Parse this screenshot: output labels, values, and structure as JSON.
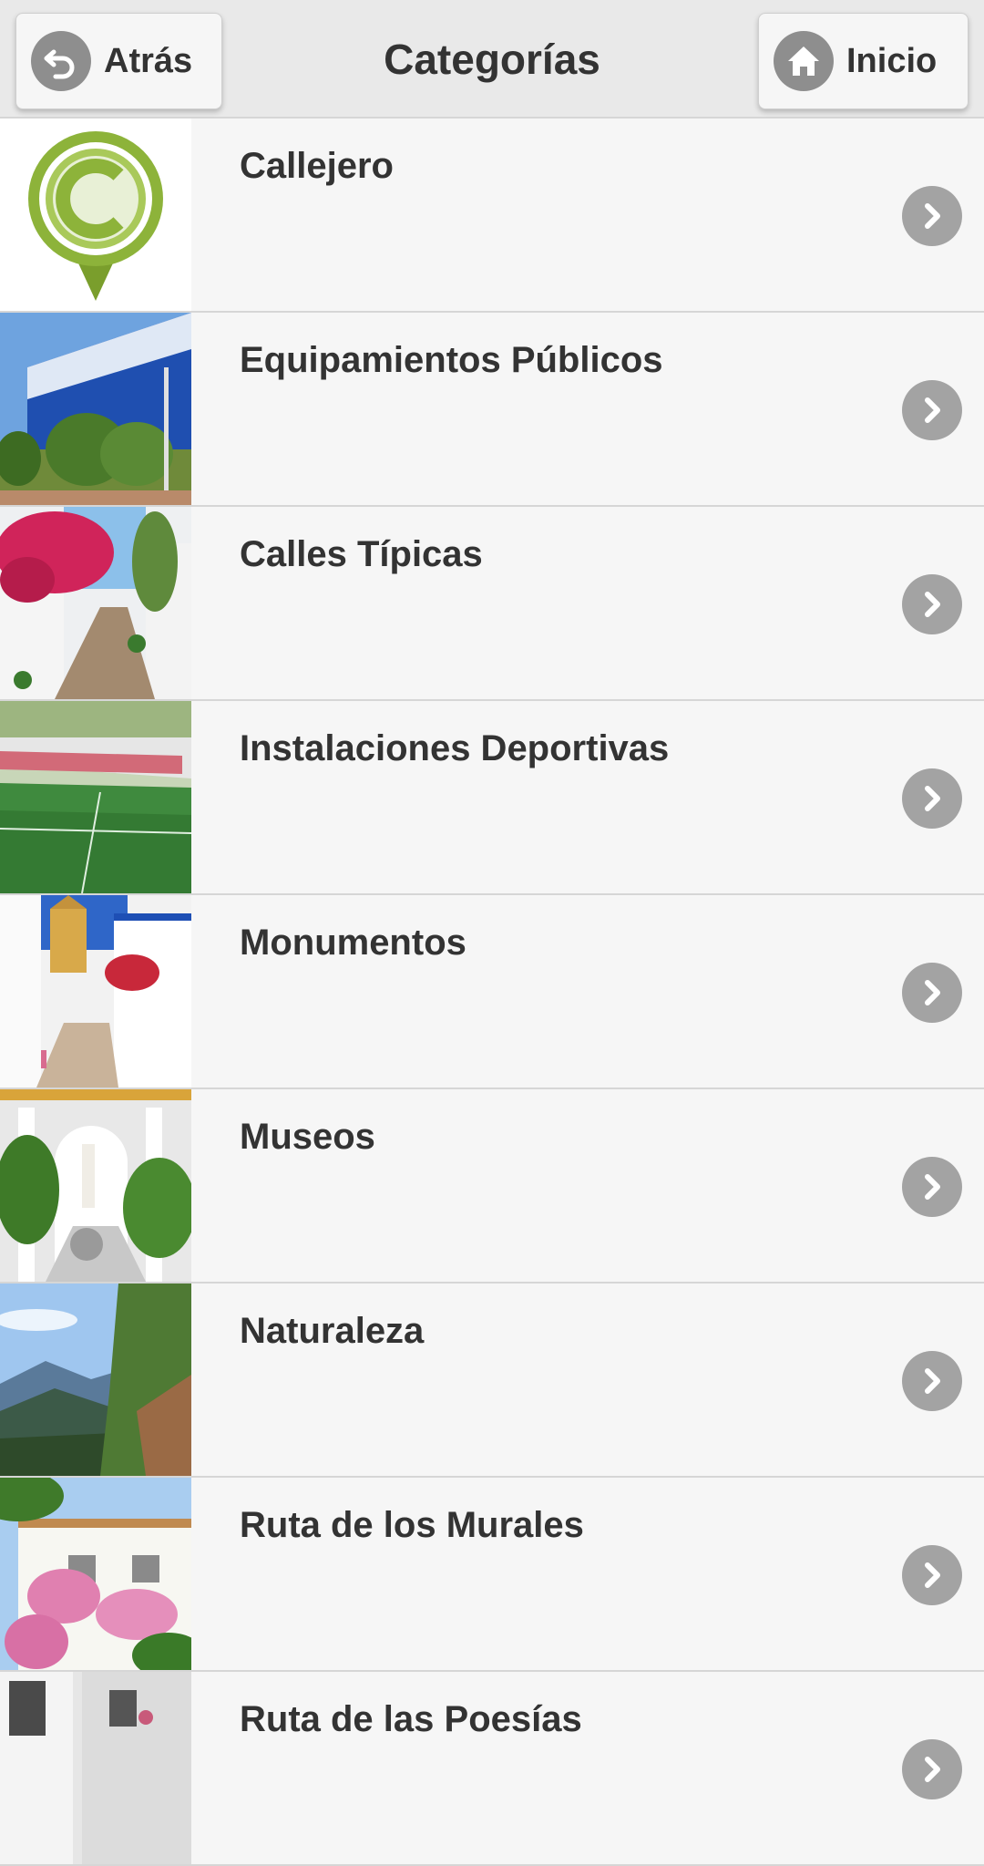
{
  "header": {
    "title": "Categorías",
    "back_label": "Atrás",
    "home_label": "Inicio",
    "back_icon": "back-arrow-icon",
    "home_icon": "home-icon"
  },
  "categories": [
    {
      "label": "Callejero",
      "thumb": "map-pin-logo"
    },
    {
      "label": "Equipamientos Públicos",
      "thumb": "congress-building-photo"
    },
    {
      "label": "Calles Típicas",
      "thumb": "flowered-street-photo"
    },
    {
      "label": "Instalaciones Deportivas",
      "thumb": "football-stadium-photo"
    },
    {
      "label": "Monumentos",
      "thumb": "church-tower-photo"
    },
    {
      "label": "Museos",
      "thumb": "patio-fountain-photo"
    },
    {
      "label": "Naturaleza",
      "thumb": "mountain-landscape-photo"
    },
    {
      "label": "Ruta de los Murales",
      "thumb": "mural-house-photo"
    },
    {
      "label": "Ruta de las Poesías",
      "thumb": "white-alley-photo"
    }
  ],
  "colors": {
    "header_bg": "#e9e9e9",
    "list_bg": "#f6f6f6",
    "icon_circle": "#8e8e8e",
    "chevron_circle": "#a3a3a3",
    "logo_green": "#8db33a",
    "text": "#333333"
  }
}
